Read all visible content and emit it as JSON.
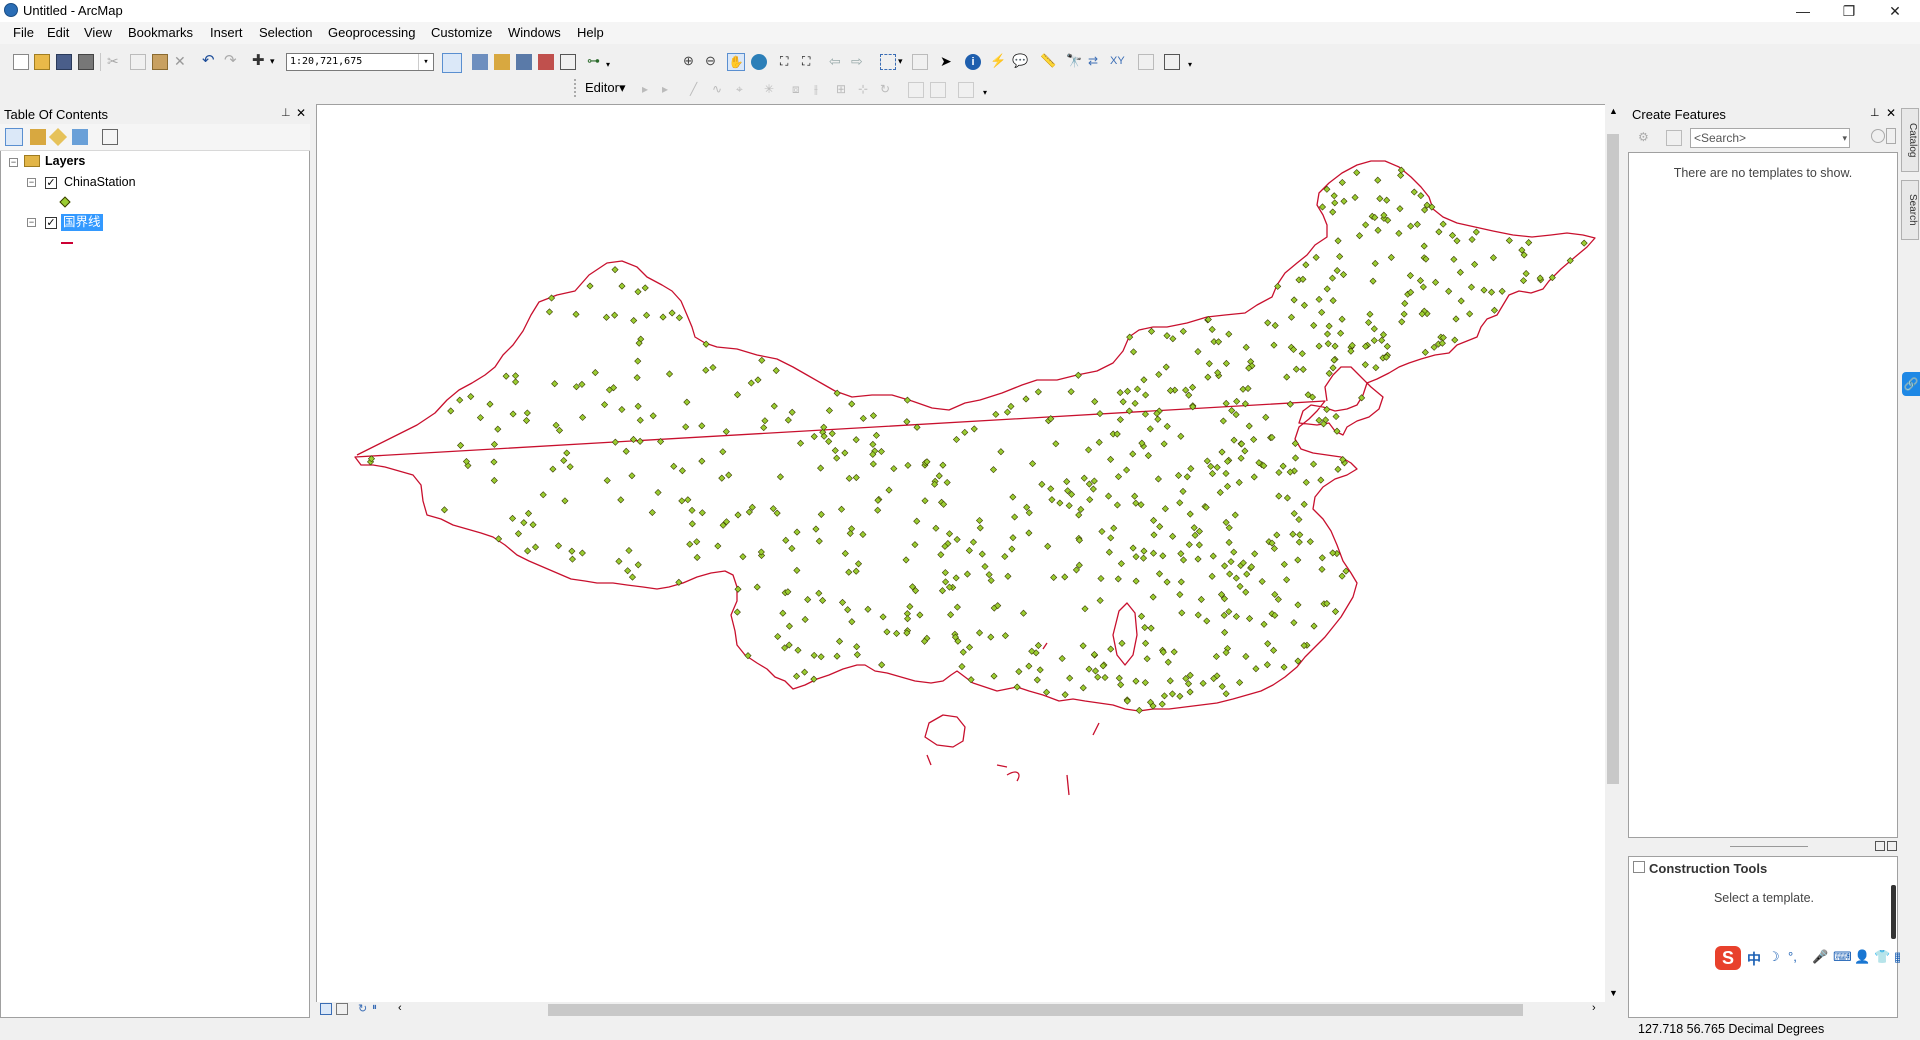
{
  "window": {
    "title": "Untitled - ArcMap",
    "minimize": "—",
    "restore": "❐",
    "close": "✕"
  },
  "menu": [
    "File",
    "Edit",
    "View",
    "Bookmarks",
    "Insert",
    "Selection",
    "Geoprocessing",
    "Customize",
    "Windows",
    "Help"
  ],
  "toolbar": {
    "scale": "1:20,721,675",
    "editor_label": "Editor▾"
  },
  "toc": {
    "title": "Table Of Contents",
    "pin": "📌",
    "close": "✕",
    "root_label": "Layers",
    "layers": [
      {
        "name": "ChinaStation",
        "checked": true,
        "symbol": "point",
        "symbol_color": "#9acd32"
      },
      {
        "name": "国界线",
        "checked": true,
        "selected": true,
        "symbol": "line",
        "symbol_color": "#cc0033"
      }
    ]
  },
  "map": {
    "boundary_color": "#c8102e",
    "station_fill": "#9acd32",
    "station_stroke": "#3a3a00"
  },
  "create_features": {
    "title": "Create Features",
    "search_placeholder": "<Search>",
    "empty_message": "There are no templates to show.",
    "construction_title": "Construction Tools",
    "construction_message": "Select a template."
  },
  "side_tabs": [
    "Catalog",
    "Search"
  ],
  "ime": {
    "logo": "S",
    "label": "中"
  },
  "status": {
    "coords": "127.718  56.765 Decimal Degrees"
  },
  "colors": {
    "selection_bg": "#3399ff",
    "panel_bg": "#f0f0f0"
  }
}
